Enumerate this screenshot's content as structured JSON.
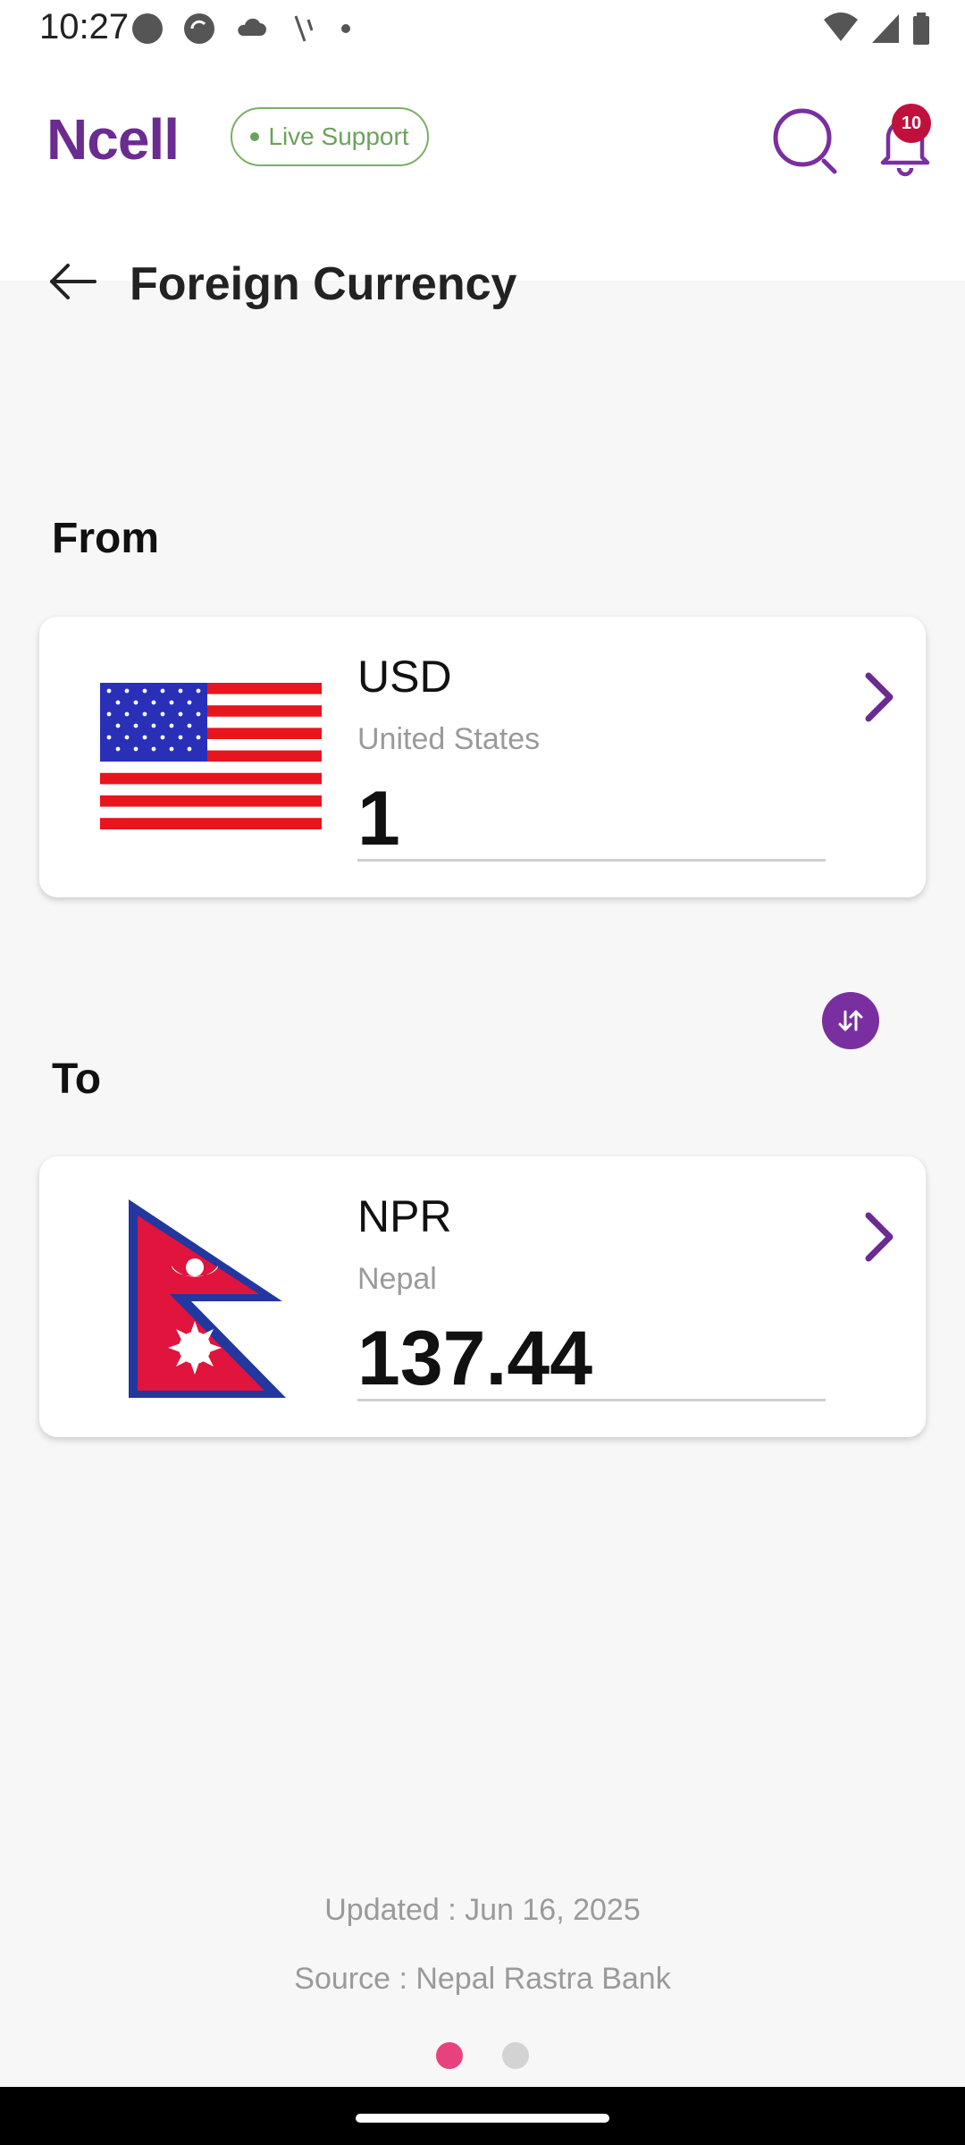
{
  "status_bar": {
    "time": "10:27"
  },
  "header": {
    "logo": "Ncell",
    "live_support": "Live Support",
    "notification_count": "10",
    "brand_color": "#6a2c91"
  },
  "page": {
    "title": "Foreign Currency"
  },
  "from": {
    "label": "From",
    "code": "USD",
    "country": "United States",
    "amount": "1",
    "flag_icon": "us-flag-icon"
  },
  "to": {
    "label": "To",
    "code": "NPR",
    "country": "Nepal",
    "amount": "137.44",
    "flag_icon": "nepal-flag-icon"
  },
  "footer": {
    "updated": "Updated : Jun 16, 2025",
    "source": "Source : Nepal Rastra Bank"
  },
  "pager": {
    "active_index": 0,
    "count": 2,
    "active_color": "#e8427c",
    "inactive_color": "#d3d3d3"
  }
}
